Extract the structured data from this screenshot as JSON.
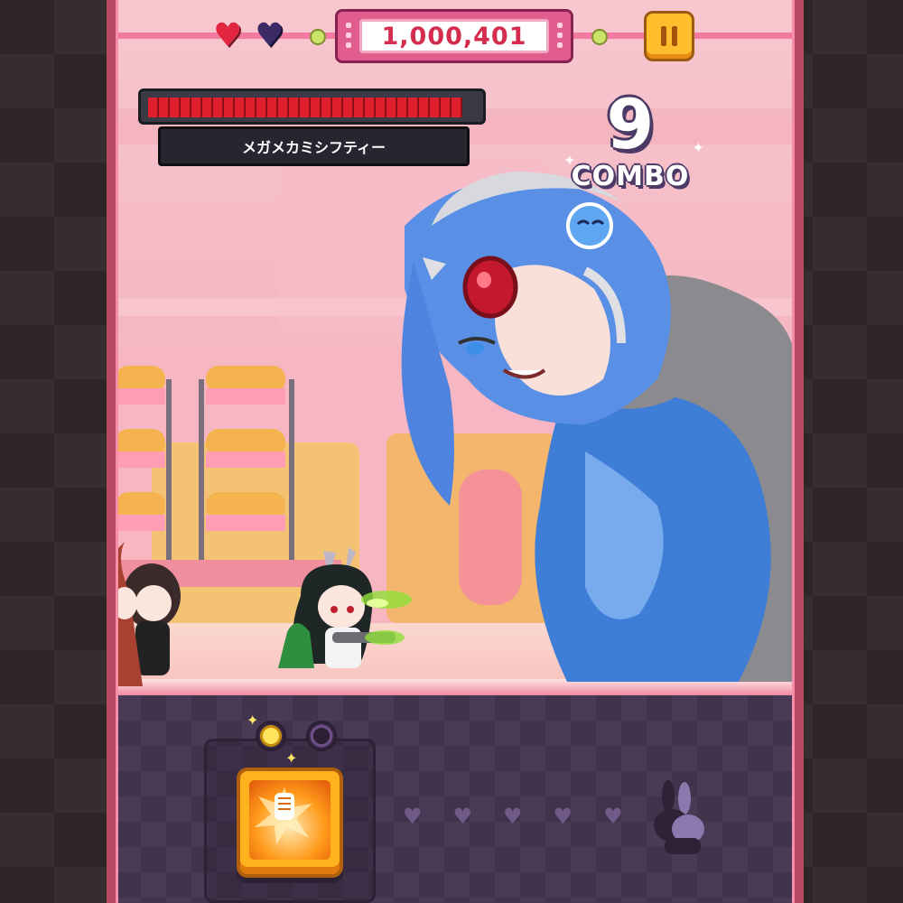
{
  "hud": {
    "lives": [
      {
        "state": "full",
        "icon": "heart-icon"
      },
      {
        "state": "empty",
        "icon": "heart-icon"
      }
    ],
    "score": "1,000,401",
    "pause_icon": "pause-icon"
  },
  "boss": {
    "name": "メガメカミシフティー",
    "hp_fraction": 0.96
  },
  "combo": {
    "count": "9",
    "label": "COMBO"
  },
  "skill": {
    "icon": "punch-burst-icon",
    "charges_total": 2,
    "charges_filled": 1
  },
  "progress_hearts": 5,
  "colors": {
    "frame": "#b94a63",
    "score_text": "#d32c4f",
    "hp_red": "#e01f2e",
    "pause_button": "#ffbe2e",
    "skill_button": "#ffb21e",
    "panel_bg": "#4a3a55"
  }
}
